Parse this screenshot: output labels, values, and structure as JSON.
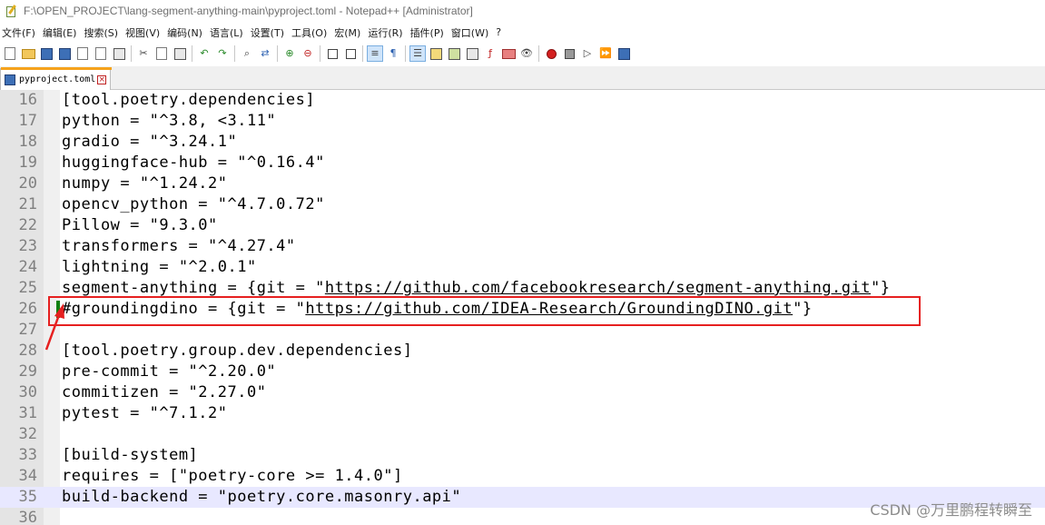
{
  "window": {
    "title": "F:\\OPEN_PROJECT\\lang-segment-anything-main\\pyproject.toml - Notepad++ [Administrator]"
  },
  "menu": [
    "文件(F)",
    "编辑(E)",
    "搜索(S)",
    "视图(V)",
    "编码(N)",
    "语言(L)",
    "设置(T)",
    "工具(O)",
    "宏(M)",
    "运行(R)",
    "插件(P)",
    "窗口(W)",
    "?"
  ],
  "tab": {
    "label": "pyproject.toml",
    "close_glyph": "×"
  },
  "editor": {
    "lines": [
      {
        "num": "16",
        "pre": "[tool.poetry.dependencies]",
        "url": "",
        "post": ""
      },
      {
        "num": "17",
        "pre": "python = \"^3.8, <3.11\"",
        "url": "",
        "post": ""
      },
      {
        "num": "18",
        "pre": "gradio = \"^3.24.1\"",
        "url": "",
        "post": ""
      },
      {
        "num": "19",
        "pre": "huggingface-hub = \"^0.16.4\"",
        "url": "",
        "post": ""
      },
      {
        "num": "20",
        "pre": "numpy = \"^1.24.2\"",
        "url": "",
        "post": ""
      },
      {
        "num": "21",
        "pre": "opencv_python = \"^4.7.0.72\"",
        "url": "",
        "post": ""
      },
      {
        "num": "22",
        "pre": "Pillow = \"9.3.0\"",
        "url": "",
        "post": ""
      },
      {
        "num": "23",
        "pre": "transformers = \"^4.27.4\"",
        "url": "",
        "post": ""
      },
      {
        "num": "24",
        "pre": "lightning = \"^2.0.1\"",
        "url": "",
        "post": ""
      },
      {
        "num": "25",
        "pre": "segment-anything = {git = \"",
        "url": "https://github.com/facebookresearch/segment-anything.git",
        "post": "\"}"
      },
      {
        "num": "26",
        "pre": "#groundingdino = {git = \"",
        "url": "https://github.com/IDEA-Research/GroundingDINO.git",
        "post": "\"}"
      },
      {
        "num": "27",
        "pre": "",
        "url": "",
        "post": ""
      },
      {
        "num": "28",
        "pre": "[tool.poetry.group.dev.dependencies]",
        "url": "",
        "post": ""
      },
      {
        "num": "29",
        "pre": "pre-commit = \"^2.20.0\"",
        "url": "",
        "post": ""
      },
      {
        "num": "30",
        "pre": "commitizen = \"2.27.0\"",
        "url": "",
        "post": ""
      },
      {
        "num": "31",
        "pre": "pytest = \"^7.1.2\"",
        "url": "",
        "post": ""
      },
      {
        "num": "32",
        "pre": "",
        "url": "",
        "post": ""
      },
      {
        "num": "33",
        "pre": "[build-system]",
        "url": "",
        "post": ""
      },
      {
        "num": "34",
        "pre": "requires = [\"poetry-core >= 1.4.0\"]",
        "url": "",
        "post": ""
      },
      {
        "num": "35",
        "pre": "build-backend = \"poetry.core.masonry.api\"",
        "url": "",
        "post": ""
      },
      {
        "num": "36",
        "pre": "",
        "url": "",
        "post": ""
      }
    ],
    "current_line": "35",
    "changed_line": "26"
  },
  "annotation": {
    "color": "#e62020"
  },
  "watermark": "CSDN @万里鹏程转瞬至",
  "colors": {
    "gutter": "#e4e4e4",
    "current_line": "#e8e8ff",
    "tab_accent": "#f6a31c",
    "changed_marker": "#108010"
  }
}
